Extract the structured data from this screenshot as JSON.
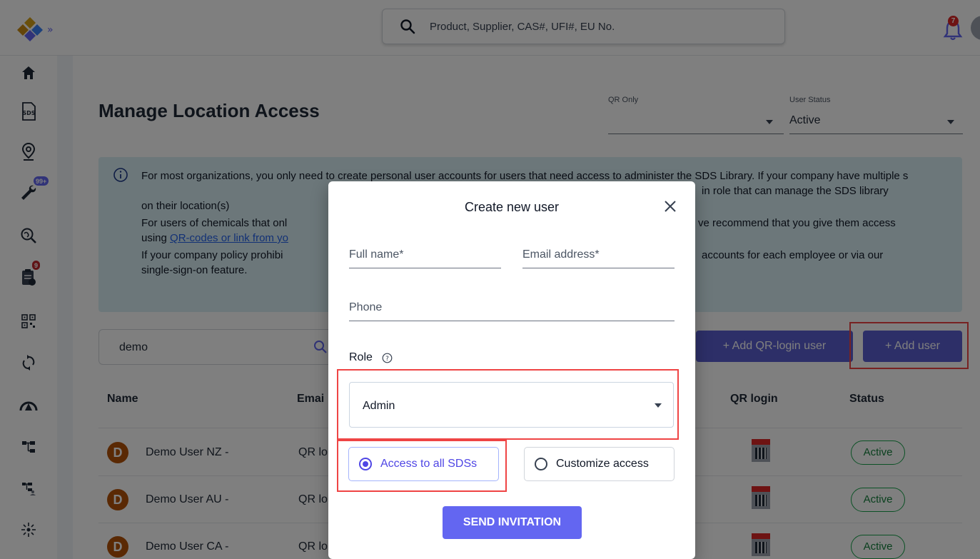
{
  "search": {
    "placeholder": "Product, Supplier, CAS#, UFI#, EU No."
  },
  "notifications": {
    "count": "7"
  },
  "sidebar": {
    "items": [
      {
        "icon": "home-icon"
      },
      {
        "icon": "sds-icon",
        "label": "SDS"
      },
      {
        "icon": "location-pin-icon"
      },
      {
        "icon": "wrench-icon",
        "badge": "99+"
      },
      {
        "icon": "search-globe-icon"
      },
      {
        "icon": "clipboard-icon",
        "badge": "9"
      },
      {
        "icon": "qr-code-icon"
      },
      {
        "icon": "sync-icon"
      },
      {
        "icon": "hazard-gauge-icon"
      },
      {
        "icon": "hierarchy-icon"
      },
      {
        "icon": "hierarchy-user-icon"
      },
      {
        "icon": "sparkle-icon"
      }
    ]
  },
  "page": {
    "title": "Manage Location Access"
  },
  "filters": {
    "qr_only": {
      "label": "QR Only",
      "value": ""
    },
    "user_status": {
      "label": "User Status",
      "value": "Active"
    }
  },
  "info": {
    "p1": "For most organizations, you only need to create personal user accounts for users that need access to administer the SDS Library. If your company have multiple s",
    "p1_tail": "in role that can manage the SDS library",
    "p1_end": "on their location(s)",
    "p2": "For users of chemicals that onl",
    "p2_tail": "ve recommend that you give them access",
    "p2_link_pre": "using ",
    "p2_link": "QR-codes or link from yo",
    "p3": "If your company policy prohibi",
    "p3_tail": "accounts for each employee or via our",
    "p3_end": "single-sign-on feature."
  },
  "list_search": {
    "value": "demo"
  },
  "buttons": {
    "add_qr_login_user": "+ Add QR-login user",
    "add_user": "+ Add user"
  },
  "table": {
    "headers": {
      "name": "Name",
      "email": "Emai",
      "qr_login": "QR login",
      "status": "Status"
    },
    "rows": [
      {
        "initial": "D",
        "name": "Demo User NZ -",
        "email": "QR lo",
        "status": "Active"
      },
      {
        "initial": "D",
        "name": "Demo User AU -",
        "email": "QR lo",
        "status": "Active"
      },
      {
        "initial": "D",
        "name": "Demo User CA -",
        "email": "QR lo",
        "status": "Active"
      }
    ]
  },
  "modal": {
    "title": "Create new user",
    "full_name": "Full name*",
    "email": "Email address*",
    "phone": "Phone",
    "role_label": "Role",
    "role_value": "Admin",
    "access_all": "Access to all SDSs",
    "customize": "Customize access",
    "send": "SEND INVITATION"
  },
  "colors": {
    "accent": "#6366f1",
    "highlight": "#ef4444",
    "info_bg": "#d9eef5",
    "active": "#16a34a"
  }
}
